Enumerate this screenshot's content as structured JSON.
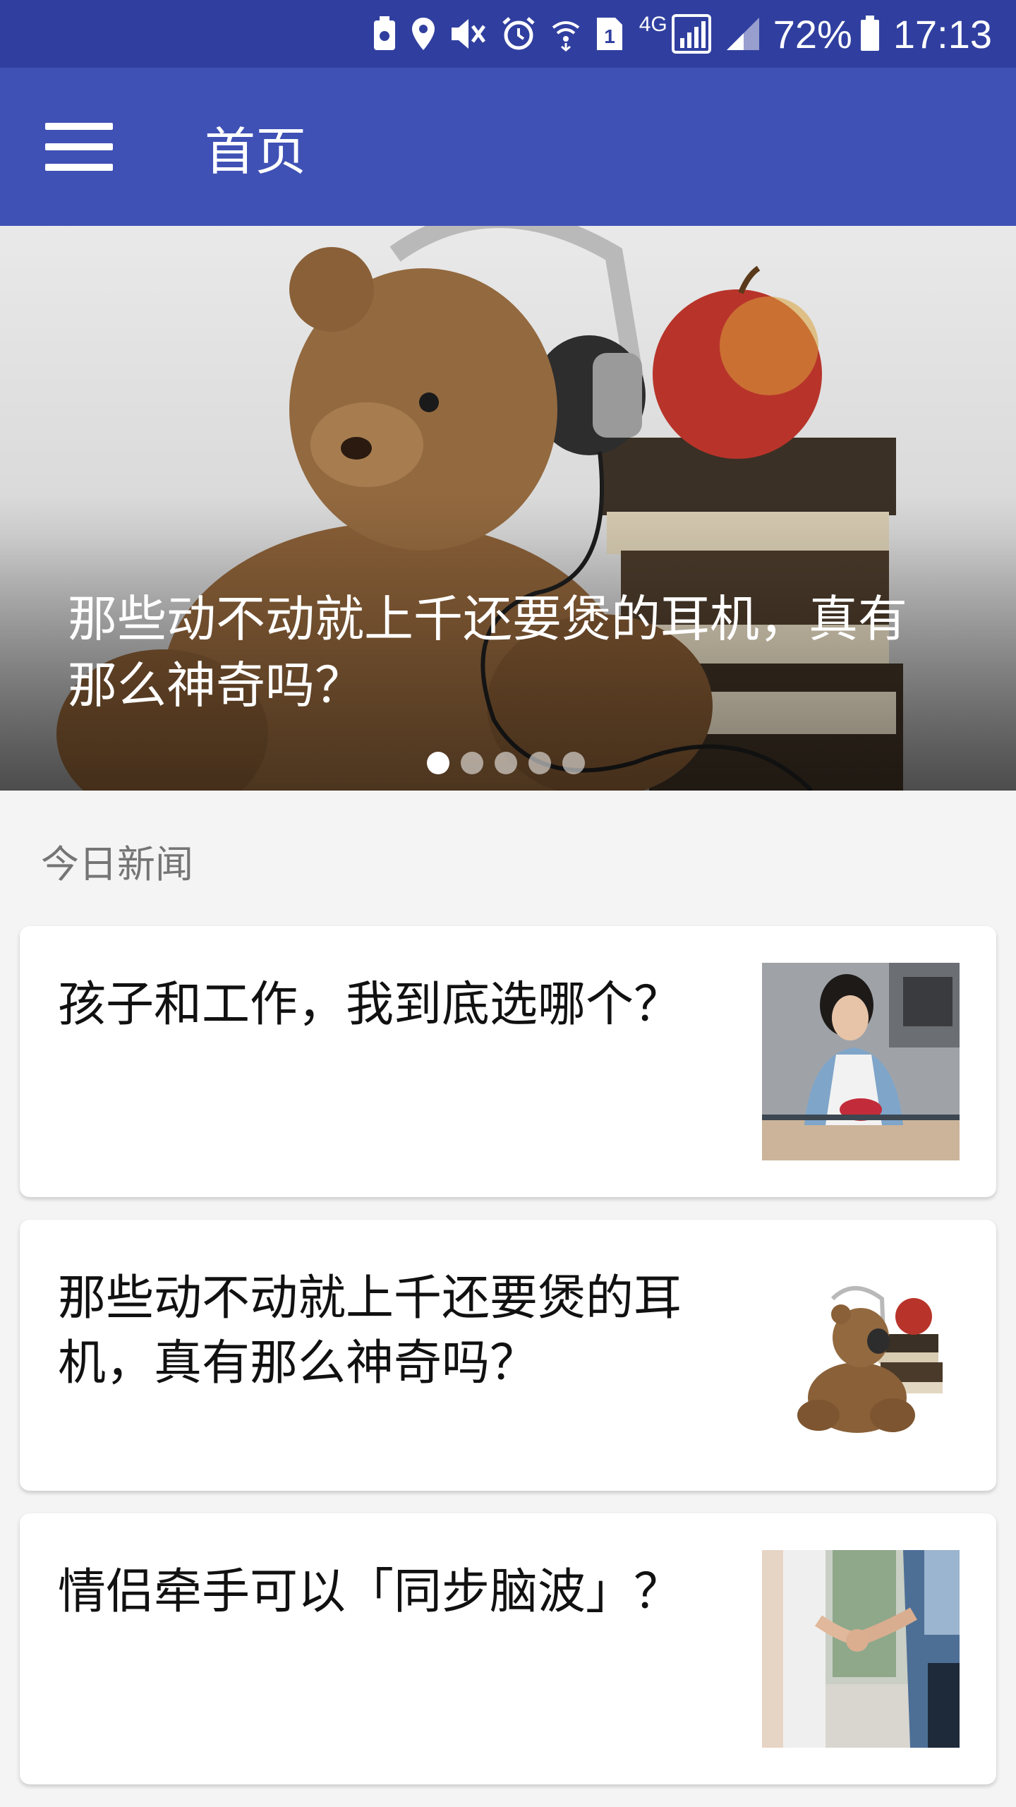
{
  "status_bar": {
    "battery": "72%",
    "time": "17:13",
    "network": "4G",
    "sim": "1",
    "icons": [
      "storage-icon",
      "location-icon",
      "mute-icon",
      "alarm-icon",
      "wifi-icon",
      "sim-icon",
      "signal-icon",
      "signal2-icon",
      "battery-icon"
    ]
  },
  "app_bar": {
    "title": "首页",
    "menu_icon": "hamburger-menu-icon",
    "color": "#3f51b5",
    "status_color": "#303f9f"
  },
  "banner": {
    "title": "那些动不动就上千还要煲的耳机，真有那么神奇吗？",
    "pages": 5,
    "active_page": 1
  },
  "section": {
    "label": "今日新闻"
  },
  "news": [
    {
      "title": "孩子和工作，我到底选哪个？",
      "thumb": "woman-painting-image"
    },
    {
      "title": "那些动不动就上千还要煲的耳机，真有那么神奇吗？",
      "thumb": "teddy-bear-headphones-image"
    },
    {
      "title": "情侣牵手可以「同步脑波」？",
      "thumb": "couple-holding-hands-image"
    }
  ]
}
